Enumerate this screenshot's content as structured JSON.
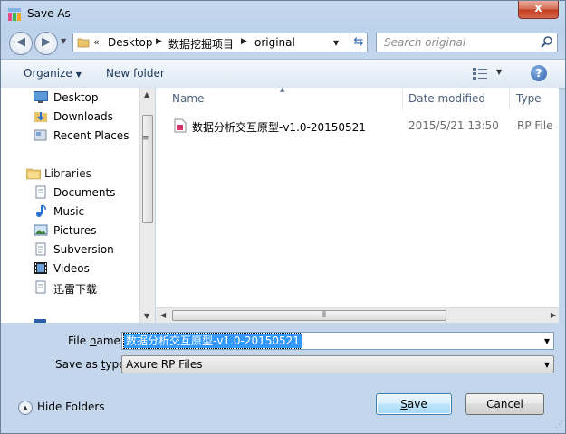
{
  "window": {
    "title": "Save As",
    "close_label": "x"
  },
  "nav": {
    "back_glyph": "◀",
    "forward_glyph": "▶",
    "breadcrumb_prefix": "«",
    "breadcrumbs": [
      "Desktop",
      "数据挖掘项目",
      "original"
    ],
    "search_placeholder": "Search original"
  },
  "toolbar": {
    "organize": "Organize",
    "new_folder": "New folder",
    "help": "?"
  },
  "sidebar": {
    "favorites": [
      {
        "label": "Desktop",
        "icon": "desktop-icon"
      },
      {
        "label": "Downloads",
        "icon": "downloads-icon"
      },
      {
        "label": "Recent Places",
        "icon": "recent-places-icon"
      }
    ],
    "libraries_label": "Libraries",
    "libraries": [
      {
        "label": "Documents",
        "icon": "documents-icon"
      },
      {
        "label": "Music",
        "icon": "music-icon"
      },
      {
        "label": "Pictures",
        "icon": "pictures-icon"
      },
      {
        "label": "Subversion",
        "icon": "subversion-icon"
      },
      {
        "label": "Videos",
        "icon": "videos-icon"
      },
      {
        "label": "迅雷下载",
        "icon": "xunlei-download-icon"
      }
    ]
  },
  "files": {
    "columns": {
      "name": "Name",
      "date": "Date modified",
      "type": "Type"
    },
    "rows": [
      {
        "name": "数据分析交互原型-v1.0-20150521",
        "date": "2015/5/21 13:50",
        "type": "RP File",
        "icon": "rp-file-icon"
      }
    ]
  },
  "form": {
    "filename_label_pre": "File ",
    "filename_label_u": "n",
    "filename_label_post": "ame:",
    "filename_value": "数据分析交互原型-v1.0-20150521",
    "type_label_pre": "Save as ",
    "type_label_u": "t",
    "type_label_post": "ype:",
    "type_value": "Axure RP Files"
  },
  "footer": {
    "hide_folders": "Hide Folders",
    "save_u": "S",
    "save_rest": "ave",
    "cancel": "Cancel"
  },
  "colors": {
    "selection": "#3399ff",
    "titlebar": "#c6d9ee",
    "close": "#c23c1e"
  }
}
